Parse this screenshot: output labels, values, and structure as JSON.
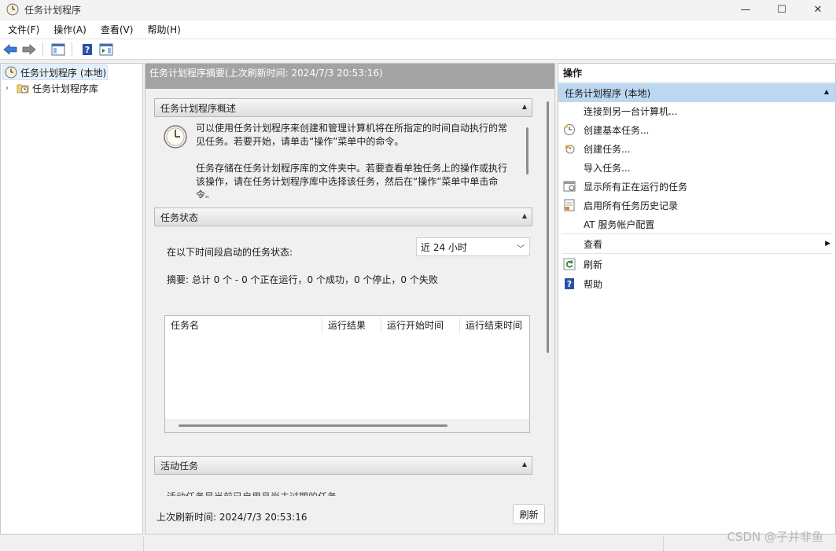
{
  "window": {
    "title": "任务计划程序",
    "minimize": "—",
    "maximize": "☐",
    "close": "✕"
  },
  "menu": [
    "文件(F)",
    "操作(A)",
    "查看(V)",
    "帮助(H)"
  ],
  "tree": {
    "root": "任务计划程序 (本地)",
    "child": "任务计划程序库"
  },
  "center": {
    "header": "任务计划程序摘要(上次刷新时间: 2024/7/3 20:53:16)",
    "overview": {
      "title": "任务计划程序概述",
      "para1": "可以使用任务计划程序来创建和管理计算机将在所指定的时间自动执行的常见任务。若要开始，请单击“操作”菜单中的命令。",
      "para2": "任务存储在任务计划程序库的文件夹中。若要查看单独任务上的操作或执行该操作，请在任务计划程序库中选择该任务，然后在“操作”菜单中单击命令。"
    },
    "status": {
      "title": "任务状态",
      "label": "在以下时间段启动的任务状态:",
      "select_value": "近 24 小时",
      "summary": "摘要: 总计 0 个 - 0 个正在运行，0 个成功，0 个停止，0 个失败",
      "columns": [
        "任务名",
        "运行结果",
        "运行开始时间",
        "运行结束时间"
      ]
    },
    "active": {
      "title": "活动任务",
      "clipped_text": "活动任务是当前已启用且尚未过期的任务。"
    },
    "footer_text": "上次刷新时间: 2024/7/3 20:53:16",
    "refresh_button": "刷新"
  },
  "actions": {
    "title": "操作",
    "group": "任务计划程序 (本地)",
    "items": [
      {
        "label": "连接到另一台计算机...",
        "icon": "none"
      },
      {
        "label": "创建基本任务...",
        "icon": "basic-task-icon"
      },
      {
        "label": "创建任务...",
        "icon": "create-task-icon"
      },
      {
        "label": "导入任务...",
        "icon": "none"
      },
      {
        "label": "显示所有正在运行的任务",
        "icon": "running-tasks-icon"
      },
      {
        "label": "启用所有任务历史记录",
        "icon": "history-icon"
      },
      {
        "label": "AT 服务帐户配置",
        "icon": "none"
      },
      {
        "label": "查看",
        "icon": "none"
      },
      {
        "label": "刷新",
        "icon": "refresh-icon"
      },
      {
        "label": "帮助",
        "icon": "help-icon"
      }
    ]
  },
  "watermark": "CSDN @子并非鱼",
  "colors": {
    "header_gray": "#a3a3a3",
    "group_blue": "#bcd7f2",
    "selected_tree": "#e5f0fb"
  }
}
